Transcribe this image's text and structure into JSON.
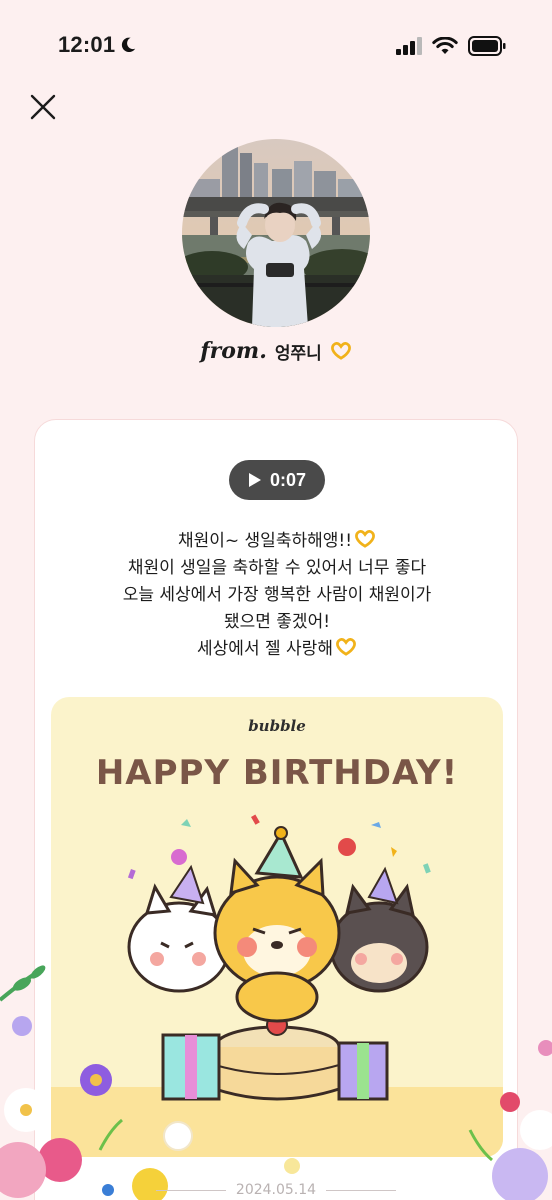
{
  "status_bar": {
    "time": "12:01"
  },
  "sender": {
    "from_label": "from.",
    "name": "엉쭈니"
  },
  "voice": {
    "duration": "0:07"
  },
  "message_lines": [
    "채원이~ 생일축하해앵!!",
    "채원이 생일을 축하할 수 있어서 너무 좋다",
    "오늘 세상에서 가장 행복한 사람이 채원이가",
    "됐으면 좋겠어!",
    "세상에서 젤 사랑해"
  ],
  "birthday_card": {
    "logo": "bubble",
    "title": "HAPPY BIRTHDAY!"
  },
  "date": "2024.05.14",
  "icons": {
    "moon": "moon-icon",
    "signal": "signal-icon",
    "wifi": "wifi-icon",
    "battery": "battery-icon",
    "close": "close-icon",
    "play": "play-icon",
    "heart_hands": "heart-hands-emoji"
  },
  "colors": {
    "background": "#fdf0f0",
    "card": "#ffffff",
    "play_pill": "#4a4a4a",
    "bday_bg": "#fbf3cb",
    "title_brown": "#7a5647"
  }
}
